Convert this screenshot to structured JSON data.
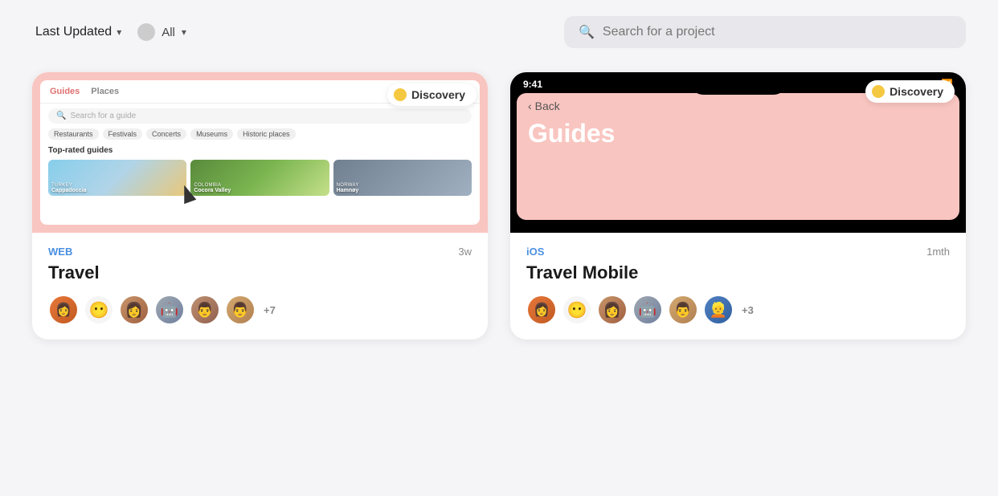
{
  "topbar": {
    "sort_label": "Last Updated",
    "sort_chevron": "▾",
    "filter_label": "All",
    "filter_chevron": "▾",
    "search_placeholder": "Search for a project"
  },
  "cards": [
    {
      "type": "web",
      "platform": "WEB",
      "time": "3w",
      "title": "Travel",
      "badge": "Discovery",
      "more_count": "+7",
      "web_preview": {
        "nav_tabs": [
          "Guides",
          "Places"
        ],
        "search_placeholder": "Search for a guide",
        "tags": [
          "Restaurants",
          "Festivals",
          "Concerts",
          "Museums",
          "Historic places"
        ],
        "section": "Top-rated guides",
        "images": [
          {
            "country": "TURKEY",
            "name": "Cappadoccia",
            "style": "turkey"
          },
          {
            "country": "COLOMBIA",
            "name": "Cocora Valley",
            "style": "colombia"
          },
          {
            "country": "NORWAY",
            "name": "Hamnøy",
            "style": "norway"
          }
        ]
      }
    },
    {
      "type": "ios",
      "platform": "iOS",
      "time": "1mth",
      "title": "Travel Mobile",
      "badge": "Discovery",
      "more_count": "+3",
      "ios_preview": {
        "time": "9:41",
        "back_label": "Back",
        "page_title": "Guides"
      }
    }
  ]
}
